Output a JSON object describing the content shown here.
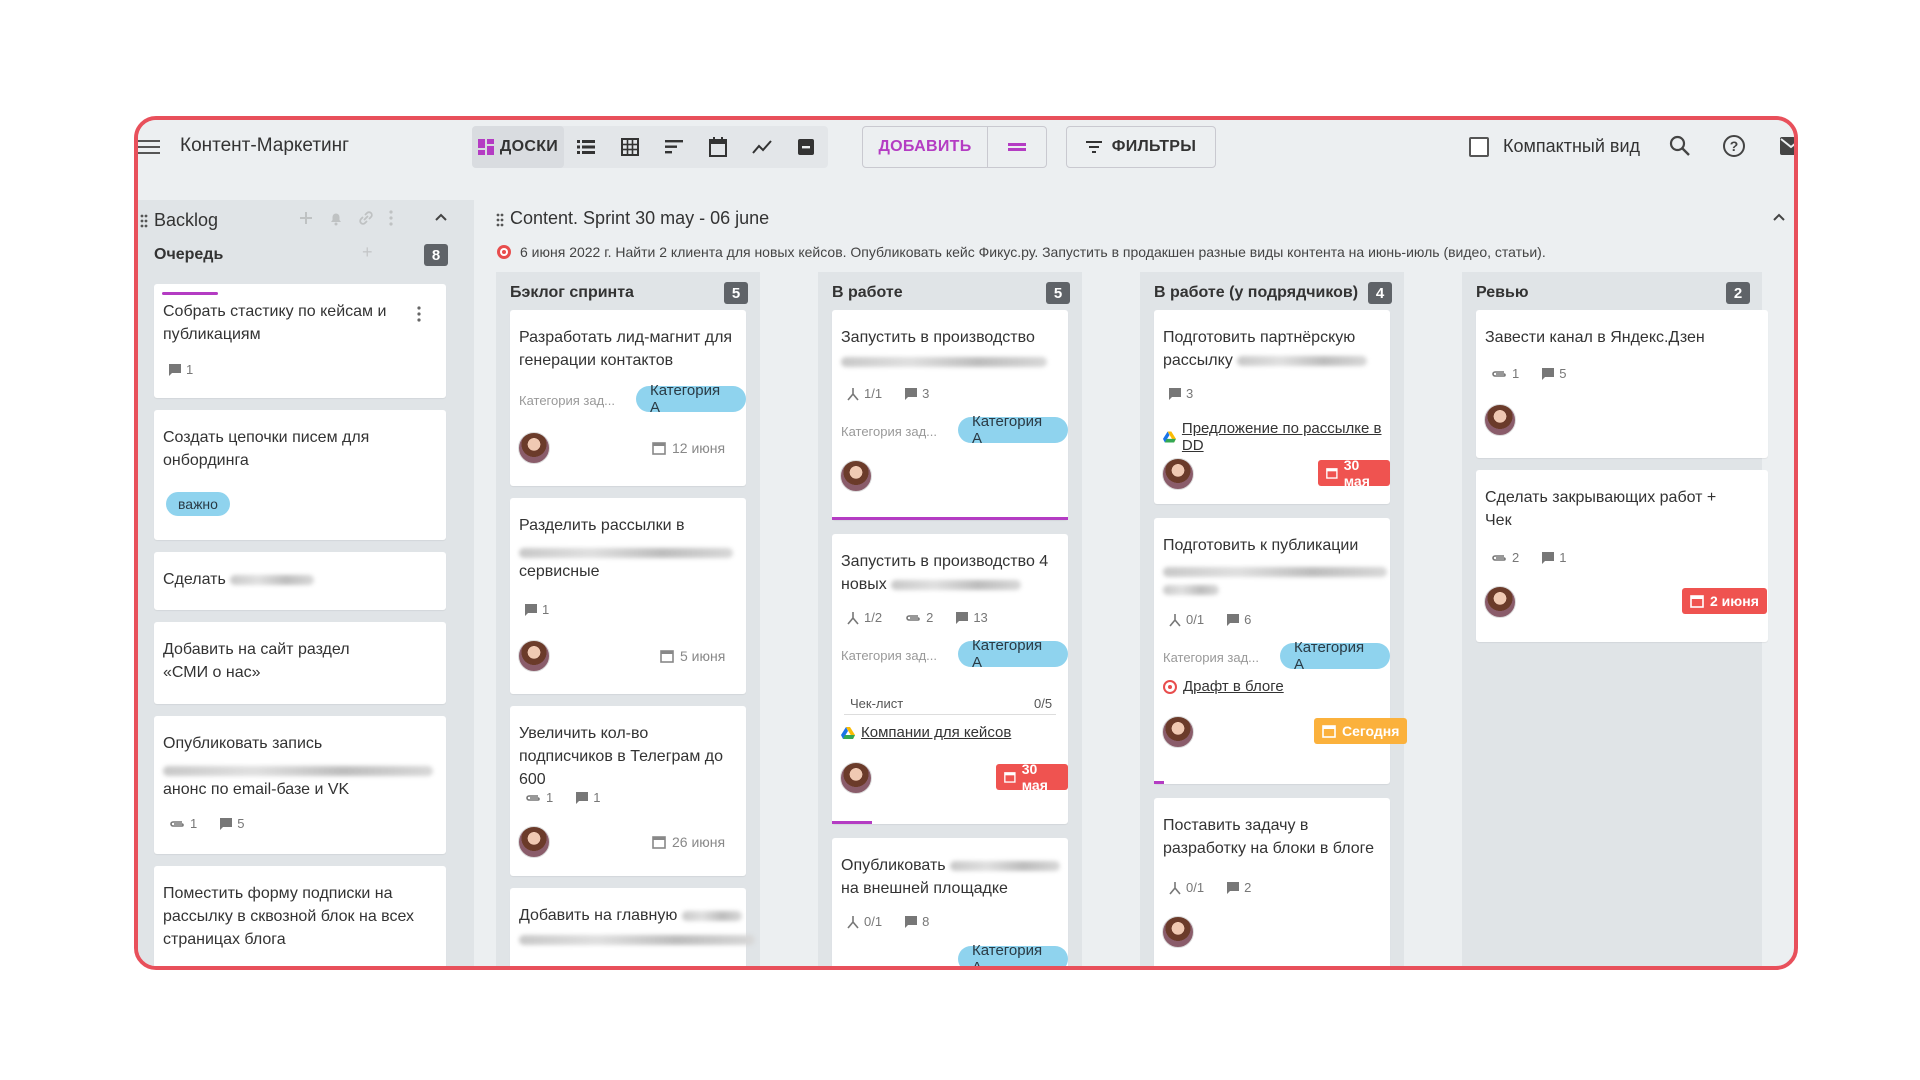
{
  "app": {
    "title": "Контент-Маркетинг"
  },
  "toolbar": {
    "boards_label": "ДОСКИ",
    "add_label": "ДОБАВИТЬ",
    "filters_label": "ФИЛЬТРЫ",
    "compact_label": "Компактный вид",
    "accent": "#b43cc3"
  },
  "backlog": {
    "title": "Backlog",
    "queue_label": "Очередь",
    "queue_count": "8",
    "cards": [
      {
        "text": "Собрать стастику по кейсам и публикациям",
        "comments": "1"
      },
      {
        "text": "Создать цепочки писем для онбординга",
        "tag": "важно"
      },
      {
        "text": "Сделать"
      },
      {
        "text": "Добавить на сайт раздел «СМИ о нас»"
      },
      {
        "text1": "Опубликовать запись",
        "text2": "анонс по email-базе и VK",
        "attachments": "1",
        "comments": "5"
      },
      {
        "text": "Поместить форму подписки на рассылку в сквозной блок на всех страницах блога"
      }
    ]
  },
  "sprint": {
    "title": "Content. Sprint 30 may - 06 june",
    "description": "6 июня 2022 г. Найти 2 клиента для новых кейсов. Опубликовать кейс Фикус.ру. Запустить в продакшен разные виды контента на июнь-июль (видео, статьи).",
    "category_label": "Категория зад...",
    "category_tag": "Категория А",
    "columns": [
      {
        "title": "Бэклог спринта",
        "count": "5",
        "cards": [
          {
            "text": "Разработать лид-магнит для генерации контактов",
            "date": "12 июня"
          },
          {
            "text1": "Разделить рассылки в",
            "text2": "сервисные",
            "comments": "1",
            "date": "5 июня"
          },
          {
            "text": "Увеличить кол-во подписчиков в Телеграм до 600",
            "attachments": "1",
            "comments": "1",
            "date": "26 июня"
          },
          {
            "text": "Добавить на главную"
          }
        ]
      },
      {
        "title": "В работе",
        "count": "5",
        "cards": [
          {
            "text": "Запустить в производство",
            "subtasks": "1/1",
            "comments": "3"
          },
          {
            "text1": "Запустить в производство 4",
            "text2": "новых",
            "subtasks": "1/2",
            "attachments": "2",
            "comments": "13",
            "checklist_label": "Чек-лист",
            "checklist_value": "0/5",
            "link": "Компании для кейсов",
            "due": "30 мая"
          },
          {
            "text1": "Опубликовать",
            "text2": "на внешней площадке",
            "subtasks": "0/1",
            "comments": "8"
          }
        ]
      },
      {
        "title": "В работе (у подрядчиков)",
        "count": "4",
        "cards": [
          {
            "text1": "Подготовить партнёрскую",
            "text2": "рассылку",
            "comments": "3",
            "link": "Предложение по рассылке в DD",
            "due": "30 мая"
          },
          {
            "text": "Подготовить к публикации",
            "subtasks": "0/1",
            "comments": "6",
            "link": "Драфт в блоге",
            "due": "Сегодня"
          },
          {
            "text": "Поставить задачу в разработку на блоки в блоге",
            "subtasks": "0/1",
            "comments": "2"
          }
        ]
      },
      {
        "title": "Ревью",
        "count": "2",
        "cards": [
          {
            "text": "Завести канал в Яндекс.Дзен",
            "attachments": "1",
            "comments": "5"
          },
          {
            "text": "Сделать закрывающих работ + Чек",
            "attachments": "2",
            "comments": "1",
            "due": "2 июня"
          }
        ]
      }
    ]
  },
  "colors": {
    "frame": "#e8505b",
    "due_red": "#ef5350",
    "due_orange": "#fbb13c",
    "tag_blue": "#8fd3ee"
  }
}
